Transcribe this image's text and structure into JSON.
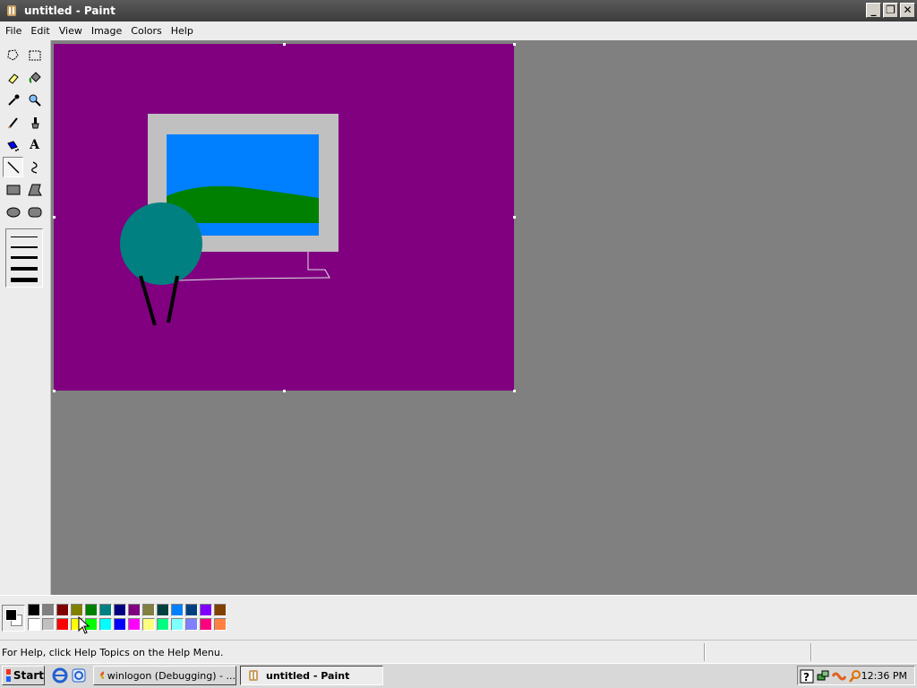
{
  "window": {
    "title": "untitled - Paint",
    "icon": "paint-icon"
  },
  "window_controls": [
    "minimize-icon",
    "restore-icon",
    "close-icon"
  ],
  "menu": [
    "File",
    "Edit",
    "View",
    "Image",
    "Colors",
    "Help"
  ],
  "tools": [
    {
      "name": "free-form-select",
      "icon": "free-select-icon"
    },
    {
      "name": "select",
      "icon": "rect-select-icon"
    },
    {
      "name": "eraser",
      "icon": "eraser-icon"
    },
    {
      "name": "fill",
      "icon": "fill-bucket-icon"
    },
    {
      "name": "pick-color",
      "icon": "eyedropper-icon"
    },
    {
      "name": "magnifier",
      "icon": "magnifier-icon"
    },
    {
      "name": "pencil",
      "icon": "pencil-icon"
    },
    {
      "name": "brush",
      "icon": "brush-icon"
    },
    {
      "name": "airbrush",
      "icon": "airbrush-icon"
    },
    {
      "name": "text",
      "icon": "text-icon",
      "glyph": "A"
    },
    {
      "name": "line",
      "icon": "line-icon",
      "active": true
    },
    {
      "name": "curve",
      "icon": "curve-icon"
    },
    {
      "name": "rectangle",
      "icon": "rectangle-icon"
    },
    {
      "name": "polygon",
      "icon": "polygon-icon"
    },
    {
      "name": "ellipse",
      "icon": "ellipse-icon"
    },
    {
      "name": "rounded-rectangle",
      "icon": "rounded-rect-icon"
    }
  ],
  "line_widths": [
    1,
    2,
    3,
    4,
    5
  ],
  "current_colors": {
    "foreground": "#000000",
    "background": "#ffffff"
  },
  "palette_top": [
    "#000000",
    "#808080",
    "#800000",
    "#808000",
    "#008000",
    "#008080",
    "#000080",
    "#800080",
    "#808040",
    "#004040",
    "#0080ff",
    "#004080",
    "#8000ff",
    "#804000"
  ],
  "palette_bottom": [
    "#ffffff",
    "#c0c0c0",
    "#ff0000",
    "#ffff00",
    "#00ff00",
    "#00ffff",
    "#0000ff",
    "#ff00ff",
    "#ffff80",
    "#00ff80",
    "#80ffff",
    "#8080ff",
    "#ff0080",
    "#ff8040"
  ],
  "canvas": {
    "background": "#800080",
    "frame_color": "#c0c0c0",
    "sky_color": "#0080ff",
    "hill_color": "#008000",
    "circle_color": "#008080",
    "stroke_color": "#000000"
  },
  "status": {
    "text": "For Help, click Help Topics on the Help Menu."
  },
  "taskbar": {
    "start_label": "Start",
    "quick_launch": [
      "ie-icon",
      "explorer-icon"
    ],
    "tasks": [
      {
        "label": "winlogon (Debugging) - ...",
        "icon": "debugger-icon",
        "active": false
      },
      {
        "label": "untitled - Paint",
        "icon": "paint-icon",
        "active": true
      }
    ],
    "tray_icons": [
      "help-icon",
      "network-icon",
      "debugger-tray-icon",
      "search-tray-icon"
    ],
    "clock": "12:36 PM"
  }
}
